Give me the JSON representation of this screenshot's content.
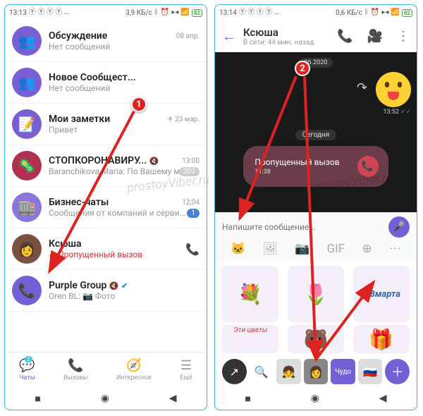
{
  "left": {
    "status": {
      "time": "13:13",
      "data": "3,9 КБ/с",
      "battery": "82"
    },
    "chats": [
      {
        "title": "Обсуждение",
        "subtitle": "Нет сообщений",
        "time": "08 апр."
      },
      {
        "title": "Новое Сообщест...",
        "subtitle": "Нет сообщений"
      },
      {
        "title": "Мои заметки",
        "subtitle": "Привет",
        "time": "✈ 23 мар."
      },
      {
        "title": "СТОПКОРОНАВИРУ...",
        "subtitle": "Baranchikova Maria: По Вашему мнению, доступнос...",
        "time": "13:00",
        "badge": "203",
        "muted": true
      },
      {
        "title": "Бизнес-чаты",
        "subtitle": "Сообщения от компаний и серви...",
        "time": "12:04",
        "badge": "1"
      },
      {
        "title": "Ксюша",
        "subtitle": "Пропущенный вызов",
        "missed": true
      },
      {
        "title": "Purple Group",
        "subtitle": "Oren BL: 📷 Фото",
        "muted": true,
        "verified": true
      }
    ],
    "nav": {
      "chats": "Чаты",
      "chats_badge": "2",
      "calls": "Вызовы",
      "explore": "Интересное",
      "more": "Ещё"
    }
  },
  "right": {
    "status": {
      "time": "13:14",
      "data": "0,6 КБ/с",
      "battery": "82"
    },
    "header": {
      "title": "Ксюша",
      "sub": "В сети: 44 мин. назад"
    },
    "date1": "06.2020",
    "msg_time": "13:52",
    "today": "Сегодня",
    "missed": {
      "title": "Пропущенный вызов",
      "time": "11:38"
    },
    "compose_placeholder": "Напишите сообщение...",
    "sticker_label_1": "С 8марта",
    "sticker_label_2": "Эти цветы"
  },
  "markers": {
    "m1": "1",
    "m2": "2"
  }
}
